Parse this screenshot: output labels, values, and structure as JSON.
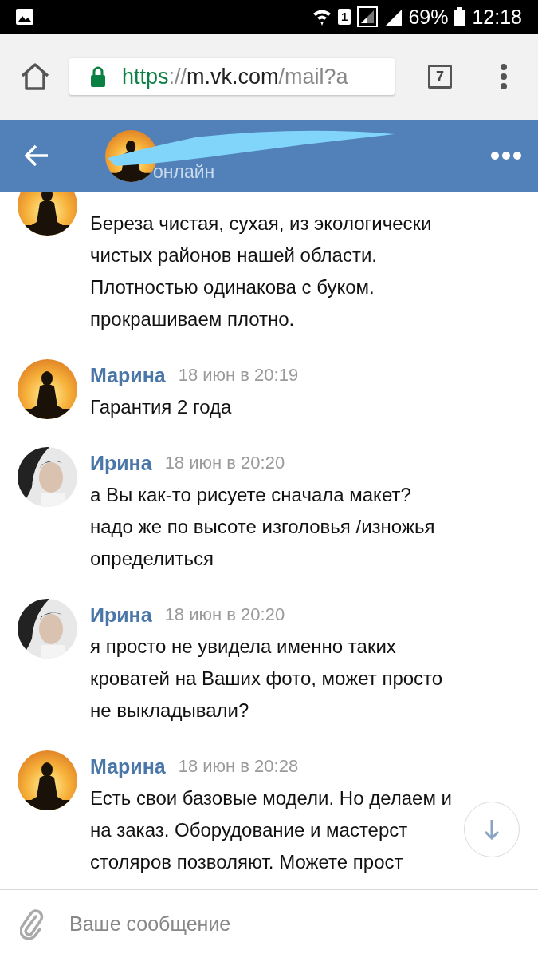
{
  "status_bar": {
    "sim_slot": "1",
    "battery": "69%",
    "time": "12:18"
  },
  "browser": {
    "url_scheme": "https",
    "url_separator": "://",
    "url_host": "m.vk.com",
    "url_path": "/mail?a",
    "tab_count": "7",
    "secure": true
  },
  "chat_header": {
    "status": "онлайн",
    "name_redacted": true
  },
  "messages": [
    {
      "text": "Береза чистая, сухая, из экологически\nчистых районов нашей области.\nПлотностью одинакова с буком.\nпрокрашиваем плотно."
    },
    {
      "sender": "Марина",
      "time": "18 июн в 20:19",
      "text": "Гарантия 2 года"
    },
    {
      "sender": "Ирина",
      "time": "18 июн в 20:20",
      "text": "а Вы как-то рисуете сначала макет?\nнадо же по высоте изголовья /изножья\nопределиться"
    },
    {
      "sender": "Ирина",
      "time": "18 июн в 20:20",
      "text": "я просто не увидела именно таких\nкроватей на Ваших фото, может просто\nне выкладывали?"
    },
    {
      "sender": "Марина",
      "time": "18 июн в 20:28",
      "text": "Есть свои базовые модели. Но делаем и\nна заказ. Оборудование и мастерст\nстоляров позволяют. Можете прост"
    }
  ],
  "composer": {
    "placeholder": "Ваше сообщение"
  }
}
